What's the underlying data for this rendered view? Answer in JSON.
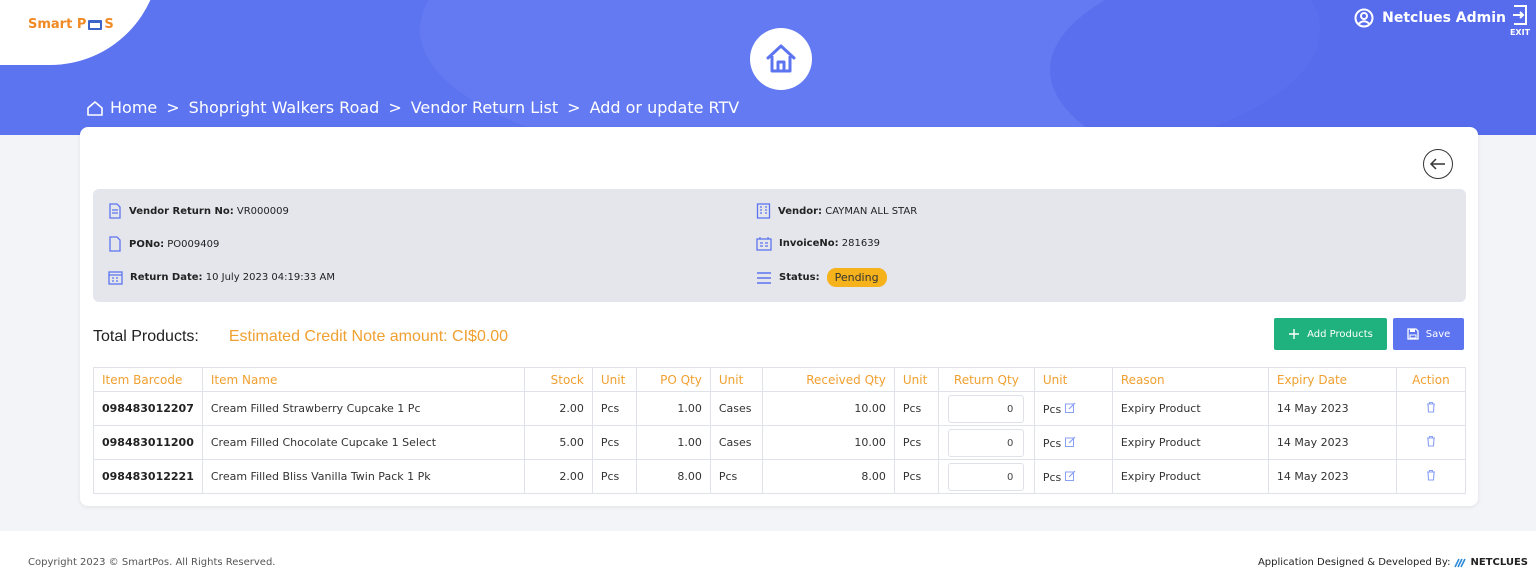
{
  "app": {
    "logo_text_a": "Smart P",
    "logo_text_b": "S",
    "user_name": "Netclues Admin",
    "exit_label": "EXIT"
  },
  "breadcrumb": [
    "Home",
    "Shopright Walkers Road",
    "Vendor Return List",
    "Add or update RTV"
  ],
  "details": {
    "vendor_return_no_label": "Vendor Return No:",
    "vendor_return_no": "VR000009",
    "po_no_label": "PONo:",
    "po_no": "PO009409",
    "return_date_label": "Return Date:",
    "return_date": "10 July 2023 04:19:33 AM",
    "vendor_label": "Vendor:",
    "vendor": "CAYMAN ALL STAR",
    "invoice_no_label": "InvoiceNo:",
    "invoice_no": "281639",
    "status_label": "Status:",
    "status": "Pending"
  },
  "summary": {
    "total_products_label": "Total Products:",
    "estimated_label": "Estimated Credit Note amount: CI$0.00"
  },
  "buttons": {
    "add_products": "Add Products",
    "save": "Save"
  },
  "table": {
    "headers": [
      "Item Barcode",
      "Item Name",
      "Stock",
      "Unit",
      "PO Qty",
      "Unit",
      "Received Qty",
      "Unit",
      "Return Qty",
      "Unit",
      "Reason",
      "Expiry Date",
      "Action"
    ],
    "rows": [
      {
        "barcode": "098483012207",
        "name": "Cream Filled Strawberry Cupcake 1 Pc",
        "stock": "2.00",
        "stock_unit": "Pcs",
        "po_qty": "1.00",
        "po_unit": "Cases",
        "received_qty": "10.00",
        "received_unit": "Pcs",
        "return_qty": "0",
        "return_unit": "Pcs",
        "reason": "Expiry Product",
        "expiry": "14 May 2023"
      },
      {
        "barcode": "098483011200",
        "name": "Cream Filled Chocolate Cupcake 1 Select",
        "stock": "5.00",
        "stock_unit": "Pcs",
        "po_qty": "1.00",
        "po_unit": "Cases",
        "received_qty": "10.00",
        "received_unit": "Pcs",
        "return_qty": "0",
        "return_unit": "Pcs",
        "reason": "Expiry Product",
        "expiry": "14 May 2023"
      },
      {
        "barcode": "098483012221",
        "name": "Cream Filled Bliss Vanilla Twin Pack 1 Pk",
        "stock": "2.00",
        "stock_unit": "Pcs",
        "po_qty": "8.00",
        "po_unit": "Pcs",
        "received_qty": "8.00",
        "received_unit": "Pcs",
        "return_qty": "0",
        "return_unit": "Pcs",
        "reason": "Expiry Product",
        "expiry": "14 May 2023"
      }
    ]
  },
  "footer": {
    "copyright": "Copyright 2023 © SmartPos. All Rights Reserved.",
    "credit": "Application Designed & Developed By:",
    "brand": "NETCLUES"
  },
  "colors": {
    "header": "#5d74f0",
    "accent_orange": "#f0a030",
    "add_button": "#1fb27e",
    "save_button": "#5d74f0",
    "status_badge": "#f6b21b"
  },
  "icons": [
    "home-icon",
    "user-circle-icon",
    "exit-icon",
    "back-arrow-icon",
    "document-icon",
    "building-icon",
    "calendar-icon",
    "invoice-icon",
    "menu-lines-icon",
    "plus-icon",
    "floppy-icon",
    "edit-icon",
    "trash-icon"
  ]
}
